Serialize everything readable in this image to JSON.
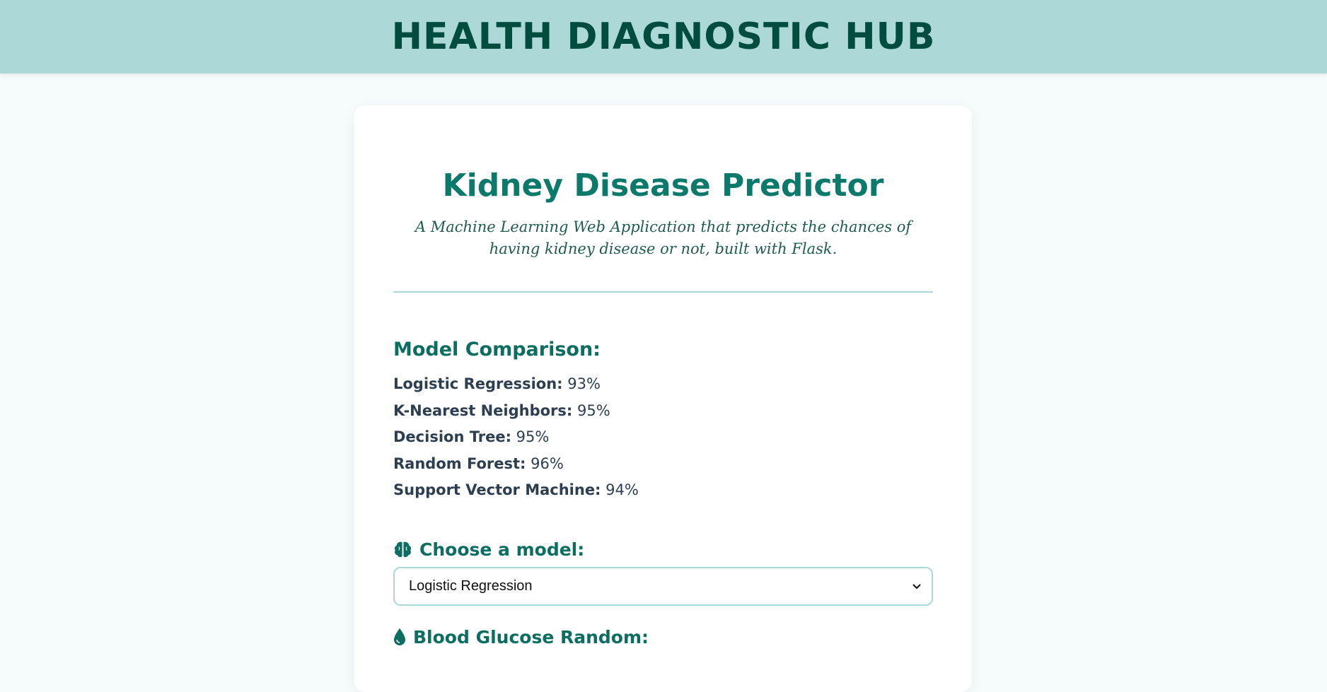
{
  "header": {
    "title": "HEALTH DIAGNOSTIC HUB"
  },
  "card": {
    "title": "Kidney Disease Predictor",
    "subtitle": "A Machine Learning Web Application that predicts the chances of having kidney disease or not, built with Flask."
  },
  "comparison": {
    "title": "Model Comparison:",
    "models": [
      {
        "name": "Logistic Regression:",
        "score": "93%"
      },
      {
        "name": "K-Nearest Neighbors:",
        "score": "95%"
      },
      {
        "name": "Decision Tree:",
        "score": "95%"
      },
      {
        "name": "Random Forest:",
        "score": "96%"
      },
      {
        "name": "Support Vector Machine:",
        "score": "94%"
      }
    ]
  },
  "form": {
    "choose_label": "Choose a model:",
    "choose_icon": "brain-icon",
    "selected_model": "Logistic Regression",
    "glucose_label": "Blood Glucose Random:",
    "glucose_icon": "droplet-icon"
  },
  "colors": {
    "header_bg": "#acd9d7",
    "header_text": "#004d40",
    "accent": "#0b7a6b",
    "text": "#2c3e50"
  }
}
